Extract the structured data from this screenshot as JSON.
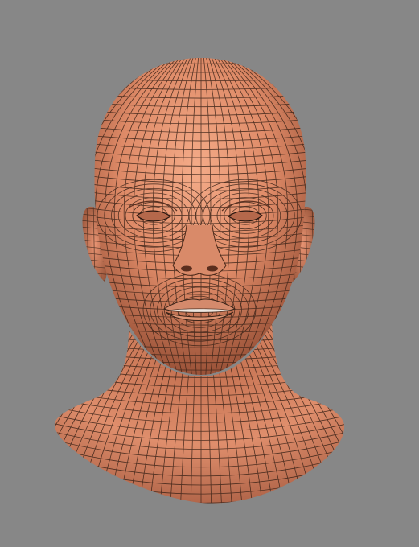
{
  "scene": {
    "subject": "3d-head-wireframe-mesh",
    "colors": {
      "background": "#878787",
      "skin_light": "#f0a07e",
      "skin_mid": "#d98563",
      "skin_dark": "#8a4a33",
      "wire": "#3a2318",
      "lips": "#d88f72",
      "teeth": "#e9e4de"
    }
  }
}
